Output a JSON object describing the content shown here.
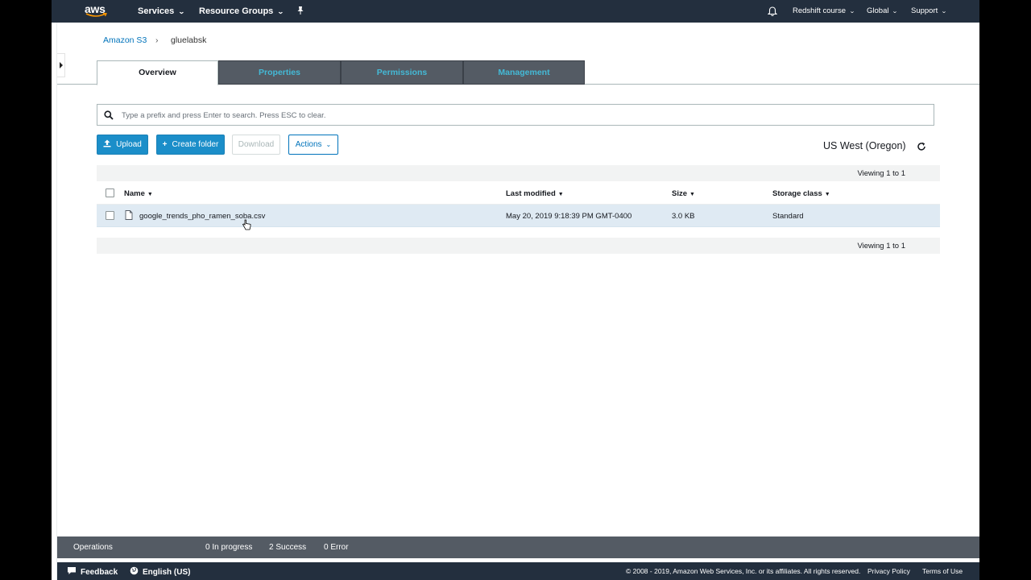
{
  "topnav": {
    "logo_text": "aws",
    "services": "Services",
    "resource_groups": "Resource Groups",
    "pin_icon": "pin-icon",
    "bell_icon": "bell-icon",
    "account": "Redshift course",
    "region": "Global",
    "support": "Support"
  },
  "breadcrumb": {
    "root": "Amazon S3",
    "separator": "›",
    "current": "gluelabsk"
  },
  "tabs": [
    {
      "label": "Overview",
      "active": true
    },
    {
      "label": "Properties",
      "active": false
    },
    {
      "label": "Permissions",
      "active": false
    },
    {
      "label": "Management",
      "active": false
    }
  ],
  "search": {
    "placeholder": "Type a prefix and press Enter to search. Press ESC to clear.",
    "value": ""
  },
  "toolbar": {
    "upload": "Upload",
    "create_folder": "Create folder",
    "download": "Download",
    "actions": "Actions",
    "region": "US West (Oregon)"
  },
  "table": {
    "viewing_top": "Viewing 1 to 1",
    "viewing_bottom": "Viewing 1 to 1",
    "columns": [
      "Name",
      "Last modified",
      "Size",
      "Storage class"
    ],
    "rows": [
      {
        "name": "google_trends_pho_ramen_soba.csv",
        "last_modified": "May 20, 2019 9:18:39 PM GMT-0400",
        "size": "3.0 KB",
        "storage_class": "Standard",
        "selected": true
      }
    ]
  },
  "operations": {
    "label": "Operations",
    "in_progress": "0 In progress",
    "success": "2 Success",
    "error": "0 Error"
  },
  "footer": {
    "feedback": "Feedback",
    "language": "English (US)",
    "copyright": "© 2008 - 2019, Amazon Web Services, Inc. or its affiliates. All rights reserved.",
    "privacy": "Privacy Policy",
    "terms": "Terms of Use"
  },
  "colors": {
    "nav_bg": "#232f3e",
    "primary": "#1b8ec9",
    "link": "#0073bb",
    "tab_inactive_bg": "#545b64",
    "tab_inactive_text": "#44b9d6",
    "row_selected": "#dfeaf3"
  }
}
